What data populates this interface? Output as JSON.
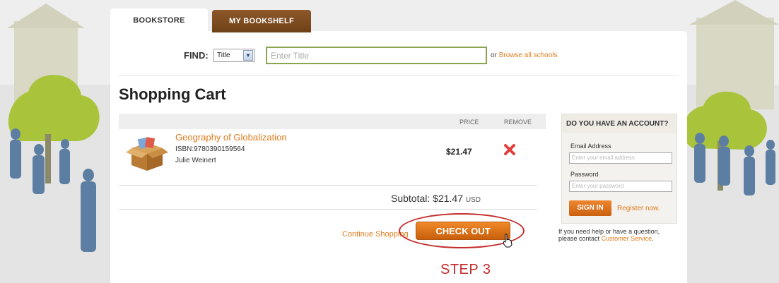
{
  "tabs": {
    "bookstore": "BOOKSTORE",
    "bookshelf": "MY BOOKSHELF"
  },
  "search": {
    "label": "FIND:",
    "selected_option": "Title",
    "placeholder": "Enter Title",
    "or_text": "or",
    "browse_link": "Browse all schools"
  },
  "page_title": "Shopping Cart",
  "cart": {
    "price_header": "PRICE",
    "remove_header": "REMOVE",
    "items": [
      {
        "title": "Geography of Globalization",
        "isbn": "ISBN:9780390159564",
        "author": "Julie Weinert",
        "price": "$21.47"
      }
    ],
    "subtotal_label": "Subtotal:",
    "subtotal_value": "$21.47",
    "currency": "USD",
    "continue_link": "Continue Shopping",
    "checkout_button": "CHECK OUT"
  },
  "annotation": {
    "step_label": "STEP 3"
  },
  "account": {
    "heading": "DO YOU HAVE AN ACCOUNT?",
    "email_label": "Email Address",
    "email_placeholder": "Enter your email address",
    "password_label": "Password",
    "password_placeholder": "Enter your password",
    "signin_button": "SIGN IN",
    "register_link": "Register now.",
    "help_text": "If you need help or have a question, please contact",
    "help_link": "Customer Service",
    "help_end": "."
  },
  "colors": {
    "accent_orange": "#e07b1c",
    "tab_brown": "#7c4b1f",
    "annotation_red": "#c42c2c",
    "search_border": "#8aa552"
  },
  "icons": [
    "dropdown-arrow-icon",
    "book-box-icon",
    "remove-x-icon",
    "hand-cursor-icon"
  ]
}
